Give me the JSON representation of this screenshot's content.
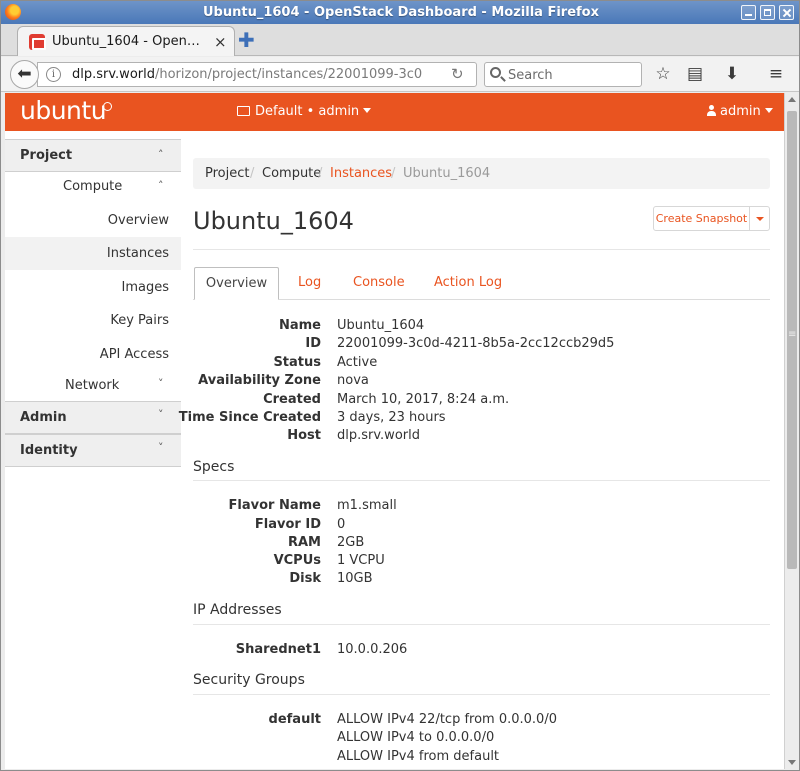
{
  "browser": {
    "window_title": "Ubuntu_1604 - OpenStack Dashboard - Mozilla Firefox",
    "tab_title": "Ubuntu_1604 - Open…",
    "tab_close": "×",
    "new_tab": "✚",
    "url_host": "dlp.srv.world",
    "url_prefix": "",
    "url_path": "/horizon/project/instances/22001099-3c0",
    "search_placeholder": "Search",
    "icons": [
      "back-icon",
      "info-icon",
      "reload-icon",
      "search-icon",
      "bookmark-star-icon",
      "reading-list-icon",
      "download-icon",
      "menu-icon"
    ]
  },
  "header": {
    "brand": "ubuntu",
    "project_selector": "Default • admin",
    "user_menu": "admin",
    "accent_color": "#e95420"
  },
  "sidebar": {
    "project": "Project",
    "compute": "Compute",
    "items": [
      {
        "label": "Overview"
      },
      {
        "label": "Instances"
      },
      {
        "label": "Images"
      },
      {
        "label": "Key Pairs"
      },
      {
        "label": "API Access"
      }
    ],
    "network": "Network",
    "admin": "Admin",
    "identity": "Identity"
  },
  "breadcrumb": {
    "project": "Project",
    "compute": "Compute",
    "instances": "Instances",
    "current": "Ubuntu_1604",
    "sep": "/"
  },
  "page": {
    "title": "Ubuntu_1604",
    "create_snapshot": "Create Snapshot"
  },
  "tabs": [
    "Overview",
    "Log",
    "Console",
    "Action Log"
  ],
  "overview": [
    {
      "key": "Name",
      "value": "Ubuntu_1604"
    },
    {
      "key": "ID",
      "value": "22001099-3c0d-4211-8b5a-2cc12ccb29d5"
    },
    {
      "key": "Status",
      "value": "Active"
    },
    {
      "key": "Availability Zone",
      "value": "nova"
    },
    {
      "key": "Created",
      "value": "March 10, 2017, 8:24 a.m."
    },
    {
      "key": "Time Since Created",
      "value": "3 days, 23 hours"
    },
    {
      "key": "Host",
      "value": "dlp.srv.world"
    }
  ],
  "specs": {
    "heading": "Specs",
    "rows": [
      {
        "key": "Flavor Name",
        "value": "m1.small"
      },
      {
        "key": "Flavor ID",
        "value": "0"
      },
      {
        "key": "RAM",
        "value": "2GB"
      },
      {
        "key": "VCPUs",
        "value": "1 VCPU"
      },
      {
        "key": "Disk",
        "value": "10GB"
      }
    ]
  },
  "ip": {
    "heading": "IP Addresses",
    "rows": [
      {
        "key": "Sharednet1",
        "value": "10.0.0.206"
      }
    ]
  },
  "security": {
    "heading": "Security Groups",
    "group": "default",
    "rules": [
      "ALLOW IPv4 22/tcp from 0.0.0.0/0",
      "ALLOW IPv4 to 0.0.0.0/0",
      "ALLOW IPv4 from default"
    ]
  }
}
